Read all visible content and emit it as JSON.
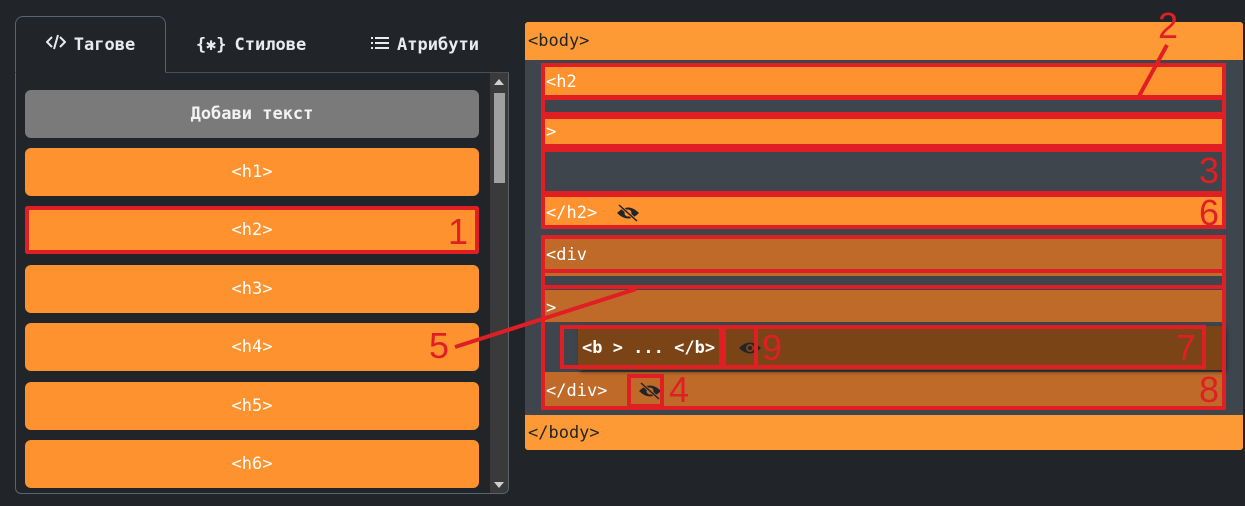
{
  "tabs": [
    {
      "label": "Тагове",
      "icon": "code-icon",
      "active": true
    },
    {
      "label": "Стилове",
      "icon": "braces-asterisk-icon",
      "active": false
    },
    {
      "label": "Атрибути",
      "icon": "list-icon",
      "active": false
    }
  ],
  "palette": {
    "add_text": "Добави текст",
    "items": [
      "<h1>",
      "<h2>",
      "<h3>",
      "<h4>",
      "<h5>",
      "<h6>"
    ]
  },
  "canvas": {
    "body_open": "<body>",
    "body_close": "</body>",
    "h2_open": "<h2",
    "h2_gt": ">",
    "h2_close": "</h2>",
    "div_open": "<div",
    "div_gt": ">",
    "b_element": "<b > ... </b>",
    "div_close": "</div>"
  },
  "annotations": [
    "1",
    "2",
    "3",
    "4",
    "5",
    "6",
    "7",
    "8",
    "9"
  ],
  "colors": {
    "orange": "#fe922e",
    "body_orange": "#fe9a35",
    "div_brown": "#c06a2a",
    "b_brown": "#7a4416",
    "annotation_red": "#e01f25",
    "background": "#212529"
  }
}
